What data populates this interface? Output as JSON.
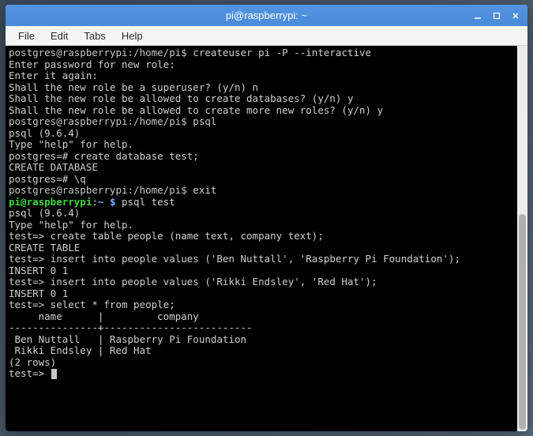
{
  "titlebar": {
    "title": "pi@raspberrypi: ~"
  },
  "menubar": {
    "file": "File",
    "edit": "Edit",
    "tabs": "Tabs",
    "help": "Help"
  },
  "terminal": {
    "lines": {
      "l0_prompt": "postgres@raspberrypi:/home/pi$ ",
      "l0_cmd": "createuser pi -P --interactive",
      "l1": "Enter password for new role:",
      "l2": "Enter it again:",
      "l3": "Shall the new role be a superuser? (y/n) n",
      "l4": "Shall the new role be allowed to create databases? (y/n) y",
      "l5": "Shall the new role be allowed to create more new roles? (y/n) y",
      "l6_prompt": "postgres@raspberrypi:/home/pi$ ",
      "l6_cmd": "psql",
      "l7": "psql (9.6.4)",
      "l8": "Type \"help\" for help.",
      "l9": "",
      "l10": "postgres=# create database test;",
      "l11": "CREATE DATABASE",
      "l12": "postgres=# \\q",
      "l13_prompt": "postgres@raspberrypi:/home/pi$ ",
      "l13_cmd": "exit",
      "l14_user": "pi@raspberrypi",
      "l14_colon": ":",
      "l14_path": "~ $",
      "l14_cmd": " psql test",
      "l15": "psql (9.6.4)",
      "l16": "Type \"help\" for help.",
      "l17": "",
      "l18": "test=> create table people (name text, company text);",
      "l19": "CREATE TABLE",
      "l20": "test=> insert into people values ('Ben Nuttall', 'Raspberry Pi Foundation');",
      "l21": "INSERT 0 1",
      "l22": "test=> insert into people values ('Rikki Endsley', 'Red Hat');",
      "l23": "INSERT 0 1",
      "l24": "test=> select * from people;",
      "l25": "     name      |         company         ",
      "l26": "---------------+-------------------------",
      "l27": " Ben Nuttall   | Raspberry Pi Foundation",
      "l28": " Rikki Endsley | Red Hat",
      "l29": "(2 rows)",
      "l30": "",
      "l31": "test=> "
    }
  }
}
